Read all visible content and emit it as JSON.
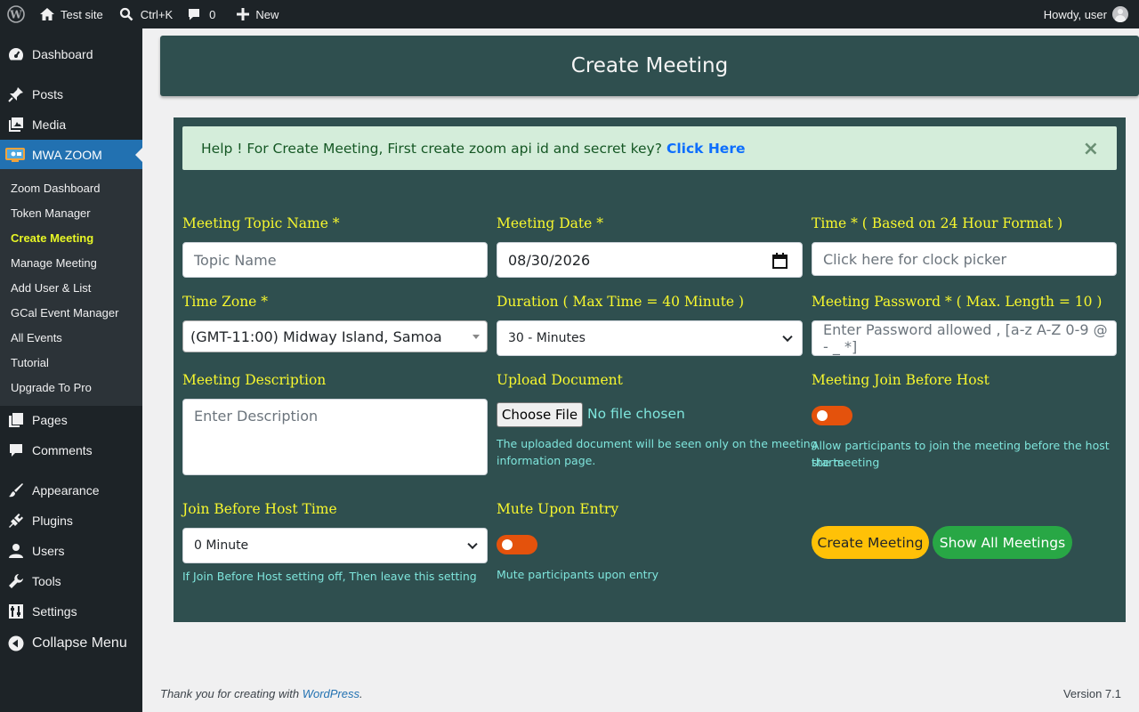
{
  "adminbar": {
    "site_name": "Test site",
    "search_shortcut": "Ctrl+K",
    "comments_count": "0",
    "new_label": "New",
    "howdy": "Howdy, user"
  },
  "sidebar": {
    "items": [
      {
        "label": "Dashboard",
        "icon": "dashboard-icon"
      },
      {
        "label": "Posts",
        "icon": "pin-icon"
      },
      {
        "label": "Media",
        "icon": "media-icon"
      },
      {
        "label": "MWA ZOOM",
        "icon": "zoom-icon"
      },
      {
        "label": "Pages",
        "icon": "pages-icon"
      },
      {
        "label": "Comments",
        "icon": "comments-icon"
      },
      {
        "label": "Appearance",
        "icon": "brush-icon"
      },
      {
        "label": "Plugins",
        "icon": "plugin-icon"
      },
      {
        "label": "Users",
        "icon": "user-icon"
      },
      {
        "label": "Tools",
        "icon": "wrench-icon"
      },
      {
        "label": "Settings",
        "icon": "settings-icon"
      },
      {
        "label": "Collapse Menu",
        "icon": "collapse-icon"
      }
    ],
    "submenu": [
      "Zoom Dashboard",
      "Token Manager",
      "Create Meeting",
      "Manage Meeting",
      "Add User & List",
      "GCal Event Manager",
      "All Events",
      "Tutorial",
      "Upgrade To Pro"
    ]
  },
  "page": {
    "title": "Create Meeting",
    "alert_text": "Help ! For Create Meeting, First create zoom api id and secret key?",
    "alert_link": "Click Here",
    "alert_close": "×"
  },
  "form": {
    "topic_label": "Meeting Topic Name *",
    "topic_placeholder": "Topic Name",
    "date_label": "Meeting Date *",
    "date_value": "08/30/2026",
    "time_label": "Time * ( Based on 24 Hour Format )",
    "time_placeholder": "Click here for clock picker",
    "timezone_label": "Time Zone *",
    "timezone_value": "(GMT-11:00) Midway Island, Samoa",
    "duration_label": "Duration ( Max Time = 40 Minute )",
    "duration_value": "30 - Minutes",
    "password_label": "Meeting Password * ( Max. Length = 10 )",
    "password_placeholder": "Enter Password allowed , [a-z A-Z 0-9 @ - _ *]",
    "description_label": "Meeting Description",
    "description_placeholder": "Enter Description",
    "upload_label": "Upload Document",
    "upload_button": "Choose File",
    "upload_status": "No file chosen",
    "upload_help_1": "The uploaded document will be seen only on the meeting",
    "upload_help_2": "information page.",
    "jbh_label": "Meeting Join Before Host",
    "jbh_help_1": "Allow participants to join the meeting before the host starts",
    "jbh_help_2": "the meeting",
    "jbh_time_label": "Join Before Host Time",
    "jbh_time_value": "0 Minute",
    "jbh_time_help": "If Join Before Host setting off, Then leave this setting",
    "mute_label": "Mute Upon Entry",
    "mute_help": "Mute participants upon entry",
    "create_button": "Create Meeting",
    "show_all_button": "Show All Meetings"
  },
  "footer": {
    "thanks_prefix": "Thank you for creating with",
    "wordpress_link": "WordPress",
    "thanks_suffix": ".",
    "version": "Version 7.1"
  }
}
